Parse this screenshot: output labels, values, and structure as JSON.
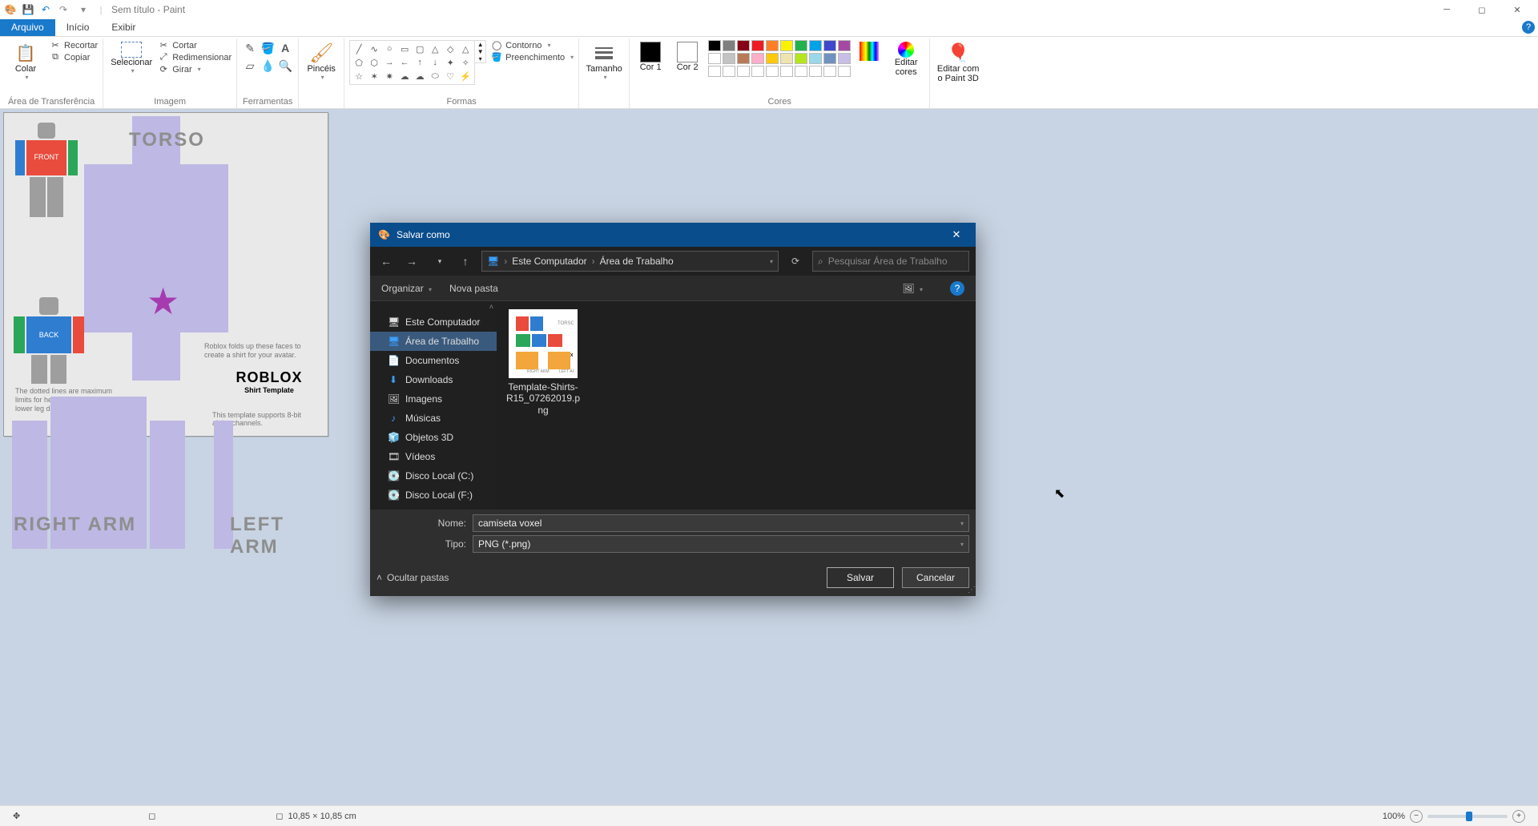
{
  "titlebar": {
    "title": "Sem título - Paint"
  },
  "tabs": {
    "file": "Arquivo",
    "home": "Início",
    "view": "Exibir"
  },
  "ribbon": {
    "clipboard": {
      "paste": "Colar",
      "cut": "Recortar",
      "copy": "Copiar",
      "group": "Área de Transferência"
    },
    "image": {
      "select": "Selecionar",
      "crop": "Cortar",
      "resize": "Redimensionar",
      "rotate": "Girar",
      "group": "Imagem"
    },
    "toolsGroup": "Ferramentas",
    "brushes": "Pincéis",
    "shapes": {
      "outline": "Contorno",
      "fill": "Preenchimento",
      "group": "Formas"
    },
    "size": "Tamanho",
    "color1": "Cor 1",
    "color2": "Cor 2",
    "editColors": "Editar cores",
    "paint3d": "Editar com o Paint 3D",
    "colorsGroup": "Cores"
  },
  "canvas": {
    "torso": "TORSO",
    "rightArm": "RIGHT ARM",
    "leftArm": "LEFT ARM",
    "rbxNote": "Roblox folds up these faces to create a shirt for your avatar.",
    "rbxLogo": "ROBLOX",
    "rbxSub": "Shirt Template",
    "tmplNote": "This template supports 8-bit alpha channels.",
    "leftNote": "The dotted lines are maximum limits for height of gloves and lower leg details on R15 only."
  },
  "dialog": {
    "title": "Salvar como",
    "crumb1": "Este Computador",
    "crumb2": "Área de Trabalho",
    "searchPlaceholder": "Pesquisar Área de Trabalho",
    "organize": "Organizar",
    "newFolder": "Nova pasta",
    "tree": {
      "pc": "Este Computador",
      "desktop": "Área de Trabalho",
      "documents": "Documentos",
      "downloads": "Downloads",
      "images": "Imagens",
      "music": "Músicas",
      "objects3d": "Objetos 3D",
      "videos": "Vídeos",
      "diskC": "Disco Local (C:)",
      "diskF": "Disco Local (F:)"
    },
    "fileThumb": "Template-Shirts-R15_07262019.png",
    "nameLabel": "Nome:",
    "nameValue": "camiseta voxel",
    "typeLabel": "Tipo:",
    "typeValue": "PNG (*.png)",
    "hideFolders": "Ocultar pastas",
    "save": "Salvar",
    "cancel": "Cancelar"
  },
  "status": {
    "dim": "10,85 × 10,85 cm",
    "zoom": "100%"
  },
  "palette_top": [
    "#000000",
    "#7f7f7f",
    "#880015",
    "#ed1c24",
    "#ff7f27",
    "#fff200",
    "#22b14c",
    "#00a2e8",
    "#3f48cc",
    "#a349a4"
  ],
  "palette_bot": [
    "#ffffff",
    "#c3c3c3",
    "#b97a57",
    "#ffaec9",
    "#ffc90e",
    "#efe4b0",
    "#b5e61d",
    "#99d9ea",
    "#7092be",
    "#c8bfe7"
  ]
}
